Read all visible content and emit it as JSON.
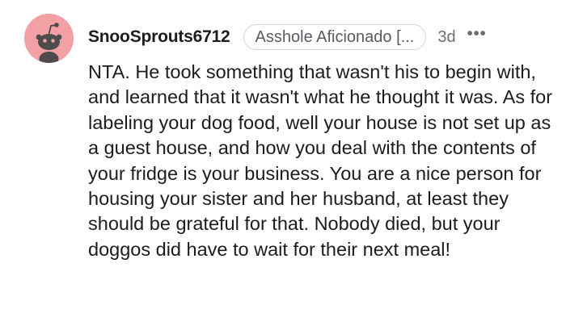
{
  "comment": {
    "avatar": {
      "icon": "snoo-avatar-icon",
      "background": "#f3a0a4"
    },
    "username": "SnooSprouts6712",
    "flair": "Asshole Aficionado [...",
    "timestamp": "3d",
    "more_label": "•••",
    "body": "NTA. He took something that wasn't his to begin with, and learned that it wasn't what he thought it was. As for labeling your dog food, well your house is not set up as a guest house, and how you deal with the contents of your fridge is your business. You are a nice person for housing your sister and her husband, at least they should be grateful for that. Nobody died, but your doggos did have to wait for their next meal!"
  }
}
